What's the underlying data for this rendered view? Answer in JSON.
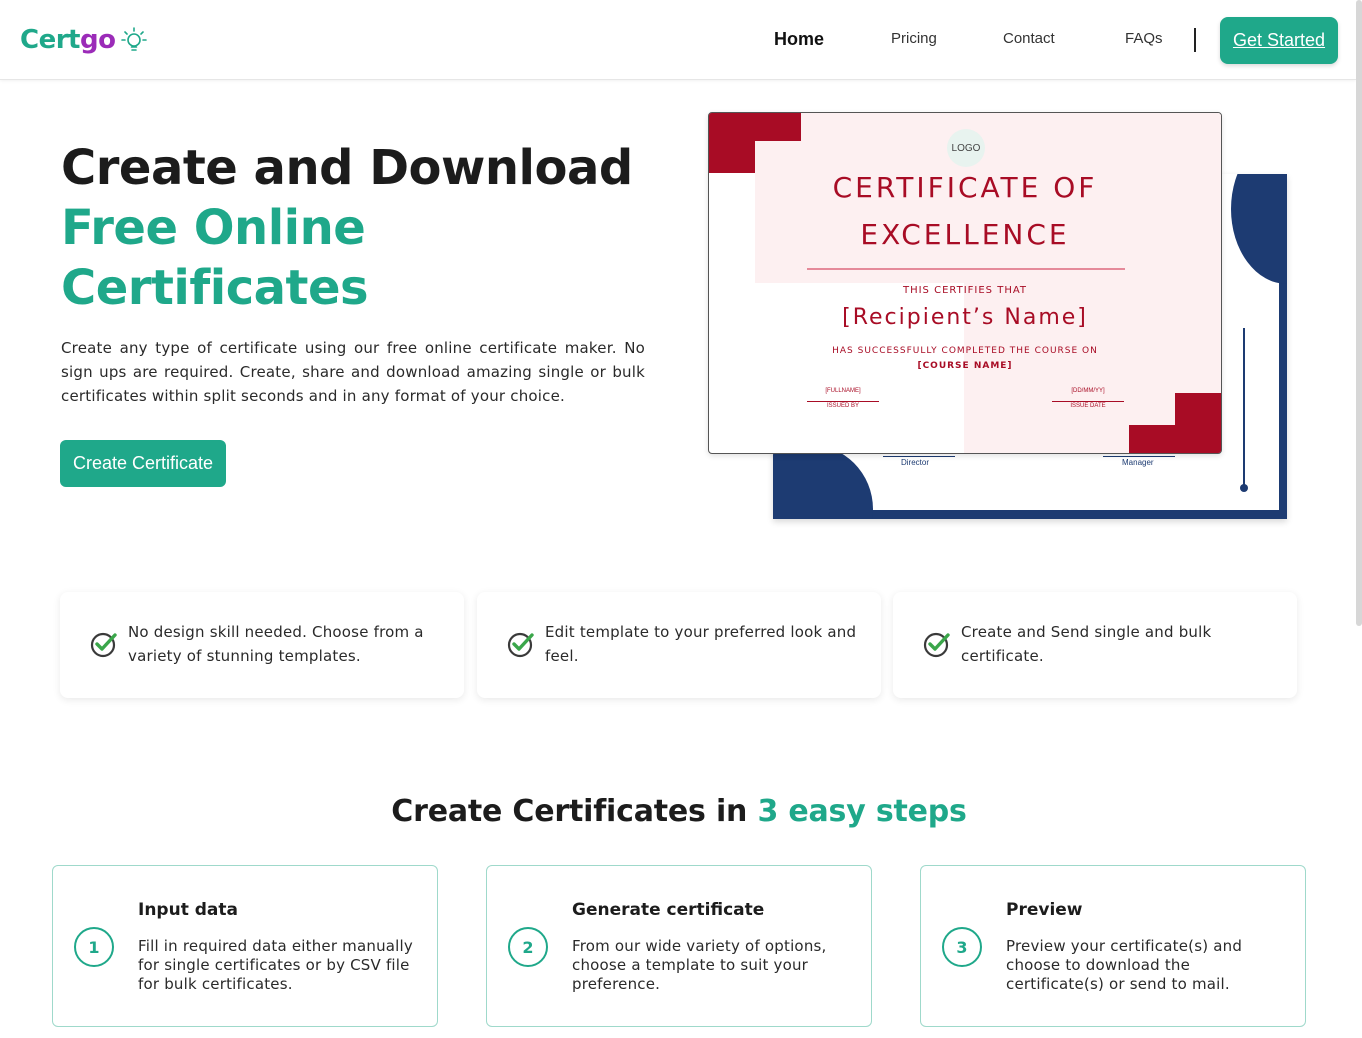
{
  "brand": {
    "name_part1": "Cert",
    "name_part2": "go",
    "icon": "lightbulb-icon"
  },
  "nav": {
    "items": [
      {
        "label": "Home",
        "active": true
      },
      {
        "label": "Pricing",
        "active": false
      },
      {
        "label": "Contact",
        "active": false
      },
      {
        "label": "FAQs",
        "active": false
      }
    ],
    "cta_label": "Get Started"
  },
  "hero": {
    "title_line1": "Create and Download",
    "title_line2": "Free Online",
    "title_line3": "Certificates",
    "description": "Create any type of certificate using our free online certificate maker. No sign ups are required. Create, share and download amazing single or bulk certificates within split seconds and in any format of your choice.",
    "cta_label": "Create Certificate"
  },
  "certificate": {
    "logo": "LOGO",
    "title_line1": "CERTIFICATE OF",
    "title_line2": "EXCELLENCE",
    "certifies": "THIS CERTIFIES THAT",
    "recipient": "[Recipient’s Name]",
    "completed": "HAS SUCCESSFULLY COMPLETED THE COURSE ON",
    "course": "[COURSE NAME]",
    "sig_left_value": "[FULLNAME]",
    "sig_left_label": "ISSUED BY",
    "sig_right_value": "[DD/MM/YY]",
    "sig_right_label": "ISSUE DATE",
    "back_sig_left": "Director",
    "back_sig_right": "Manager"
  },
  "features": [
    {
      "icon": "check-circle-icon",
      "text": "No design skill needed. Choose from a variety of stunning templates."
    },
    {
      "icon": "check-circle-icon",
      "text": "Edit template to your preferred look and feel."
    },
    {
      "icon": "check-circle-icon",
      "text": "Create and Send single and bulk certificate."
    }
  ],
  "steps_section": {
    "title_prefix": "Create Certificates in",
    "title_accent": "3 easy steps",
    "steps": [
      {
        "number": "1",
        "title": "Input data",
        "description": "Fill in required data either manually for single certificates or by CSV file for bulk certificates."
      },
      {
        "number": "2",
        "title": "Generate certificate",
        "description": "From our wide variety of options, choose a template to suit your preference."
      },
      {
        "number": "3",
        "title": "Preview",
        "description": "Preview your certificate(s) and choose to download the certificate(s) or send to mail."
      }
    ]
  },
  "colors": {
    "brand_green": "#1fa88a",
    "brand_purple": "#9b2bb8",
    "cert_red": "#a80c25",
    "cert_navy": "#1d3b72",
    "check_green": "#3aa64a"
  }
}
